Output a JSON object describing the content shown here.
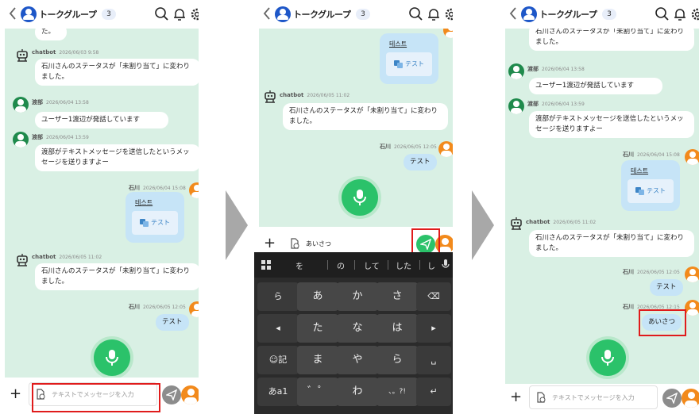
{
  "header": {
    "title": "トークグループ",
    "member_count": "3"
  },
  "input": {
    "placeholder": "テキストでメッセージを入力"
  },
  "screens": [
    {
      "messages": {
        "top_fragment": "た。",
        "m1": {
          "sender": "chatbot",
          "time": "2026/06/03 9:58",
          "text": "石川さんのステータスが「未割り当て」に変わりました。"
        },
        "m2": {
          "sender": "渡部",
          "time": "2026/06/04 13:58",
          "text": "ユーザー1渡辺が発話しています"
        },
        "m3": {
          "sender": "渡部",
          "time": "2026/06/04 13:59",
          "text": "渡部がテキストメッセージを送信したというメッセージを送りますよー"
        },
        "m4": {
          "sender": "石川",
          "time": "2026/06/04 15:08",
          "title": "테스트",
          "translated": "テスト"
        },
        "m5": {
          "sender": "chatbot",
          "time": "2026/06/05 11:02",
          "text": "石川さんのステータスが「未割り当て」に変わりました。"
        },
        "m6": {
          "sender": "石川",
          "time": "2026/06/05 12:05",
          "text": "テスト"
        }
      }
    },
    {
      "messages": {
        "m4": {
          "title": "테스트",
          "translated": "テスト"
        },
        "m5": {
          "sender": "chatbot",
          "time": "2026/06/05 11:02",
          "text": "石川さんのステータスが「未割り当て」に変わりました。"
        },
        "m6": {
          "sender": "石川",
          "time": "2026/06/05 12:05",
          "text": "テスト"
        }
      },
      "input_value": "あいさつ",
      "keyboard": {
        "suggestions": [
          "を",
          "の",
          "して",
          "した",
          "し"
        ],
        "rows": [
          [
            "ら",
            "あ",
            "か",
            "さ",
            "⌫"
          ],
          [
            "◂",
            "た",
            "な",
            "は",
            "▸"
          ],
          [
            "☺記",
            "ま",
            "や",
            "ら",
            "␣"
          ],
          [
            "あa1",
            "゛゜",
            "わ",
            "、。?!",
            "↵"
          ]
        ]
      }
    },
    {
      "messages": {
        "top_fragment": "石川さんのステータスが「未割り当て」に変わりました。",
        "m2": {
          "sender": "渡部",
          "time": "2026/06/04 13:58",
          "text": "ユーザー1渡辺が発話しています"
        },
        "m3": {
          "sender": "渡部",
          "time": "2026/06/04 13:59",
          "text": "渡部がテキストメッセージを送信したというメッセージを送りますよー"
        },
        "m4": {
          "sender": "石川",
          "time": "2026/06/04 15:08",
          "title": "테스트",
          "translated": "テスト"
        },
        "m5": {
          "sender": "chatbot",
          "time": "2026/06/05 11:02",
          "text": "石川さんのステータスが「未割り当て」に変わりました。"
        },
        "m6": {
          "sender": "石川",
          "time": "2026/06/05 12:05",
          "text": "テスト"
        },
        "m7": {
          "sender": "石川",
          "time": "2026/06/05 12:15",
          "text": "あいさつ"
        }
      }
    }
  ],
  "colors": {
    "chat_bg": "#d9f0e4",
    "my_bubble": "#c6e4f7",
    "mic": "#2bc26a",
    "highlight": "#e01b1b",
    "avatar_me": "#f28a1c",
    "avatar_other": "#1f8a4c"
  },
  "icons": [
    "back-chevron-icon",
    "group-avatar-icon",
    "search-icon",
    "bell-icon",
    "gear-icon",
    "robot-icon",
    "microphone-icon",
    "attach-file-icon",
    "send-icon",
    "translate-icon"
  ]
}
